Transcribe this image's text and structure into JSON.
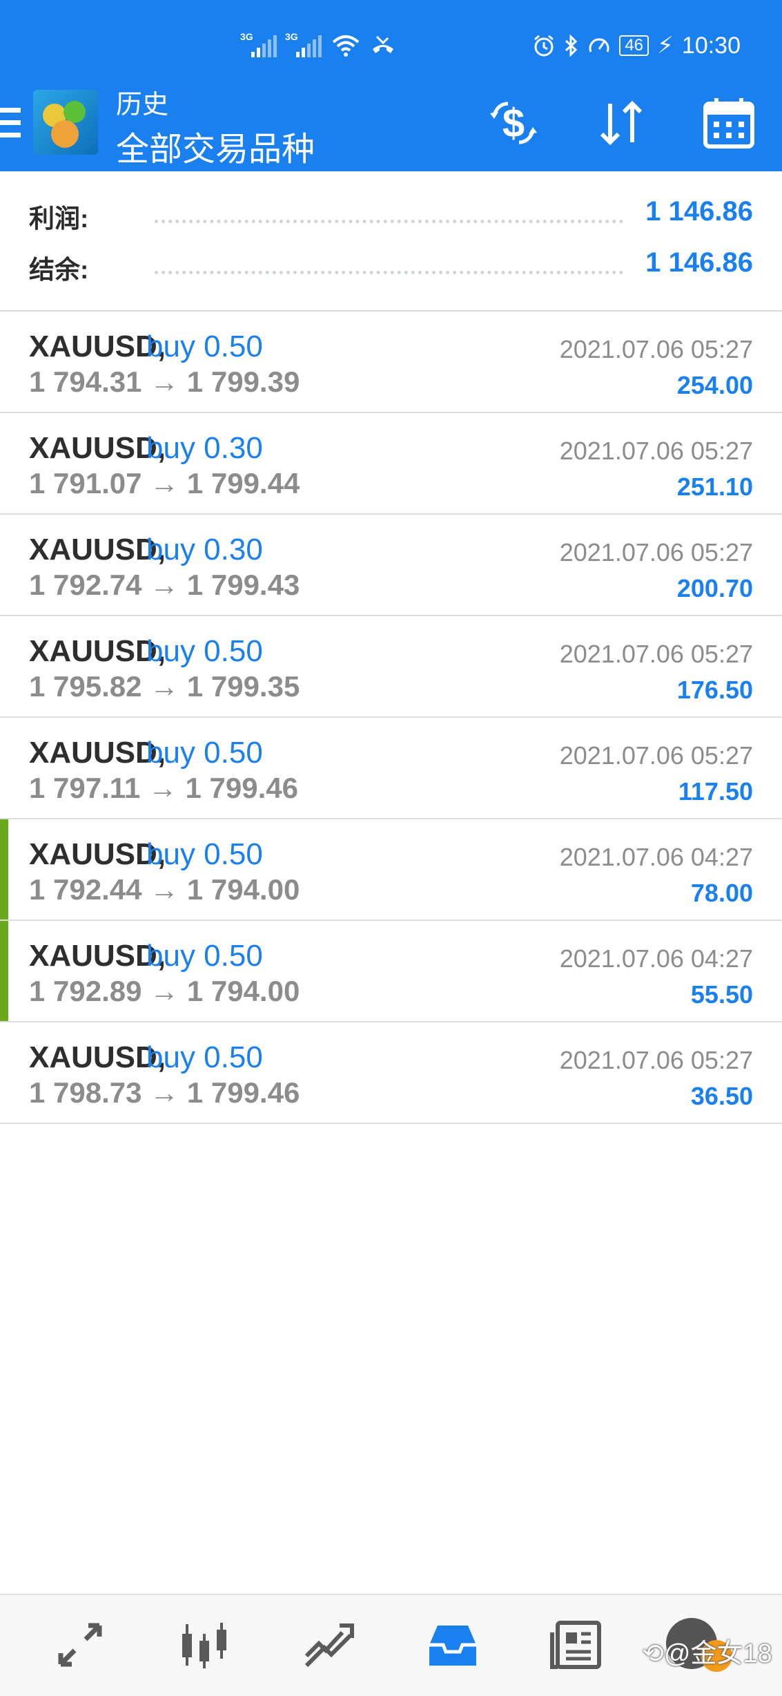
{
  "status_bar": {
    "signal_1": "3G",
    "signal_2": "3G",
    "battery": "46",
    "time": "10:30"
  },
  "header": {
    "subtitle": "历史",
    "title": "全部交易品种",
    "accent_color": "#1a80f0"
  },
  "summary": {
    "profit_label": "利润:",
    "profit_value": "1 146.86",
    "balance_label": "结余:",
    "balance_value": "1 146.86"
  },
  "deals": [
    {
      "symbol": "XAUUSD,",
      "direction": "buy 0.50",
      "prices": "1 794.31 → 1 799.39",
      "time": "2021.07.06 05:27",
      "profit": "254.00"
    },
    {
      "symbol": "XAUUSD,",
      "direction": "buy 0.30",
      "prices": "1 791.07 → 1 799.44",
      "time": "2021.07.06 05:27",
      "profit": "251.10"
    },
    {
      "symbol": "XAUUSD,",
      "direction": "buy 0.30",
      "prices": "1 792.74 → 1 799.43",
      "time": "2021.07.06 05:27",
      "profit": "200.70"
    },
    {
      "symbol": "XAUUSD,",
      "direction": "buy 0.50",
      "prices": "1 795.82 → 1 799.35",
      "time": "2021.07.06 05:27",
      "profit": "176.50"
    },
    {
      "symbol": "XAUUSD,",
      "direction": "buy 0.50",
      "prices": "1 797.11 → 1 799.46",
      "time": "2021.07.06 05:27",
      "profit": "117.50"
    },
    {
      "symbol": "XAUUSD,",
      "direction": "buy 0.50",
      "prices": "1 792.44 → 1 794.00",
      "time": "2021.07.06 04:27",
      "profit": "78.00"
    },
    {
      "symbol": "XAUUSD,",
      "direction": "buy 0.50",
      "prices": "1 792.89 → 1 794.00",
      "time": "2021.07.06 04:27",
      "profit": "55.50"
    },
    {
      "symbol": "XAUUSD,",
      "direction": "buy 0.50",
      "prices": "1 798.73 → 1 799.46",
      "time": "2021.07.06 05:27",
      "profit": "36.50"
    }
  ],
  "bottom_nav": {
    "items": [
      "quotes-icon",
      "chart-icon",
      "trade-icon",
      "history-icon",
      "news-icon",
      "chat-icon"
    ],
    "active": "history-icon",
    "watermark": "⟲@金女18"
  }
}
